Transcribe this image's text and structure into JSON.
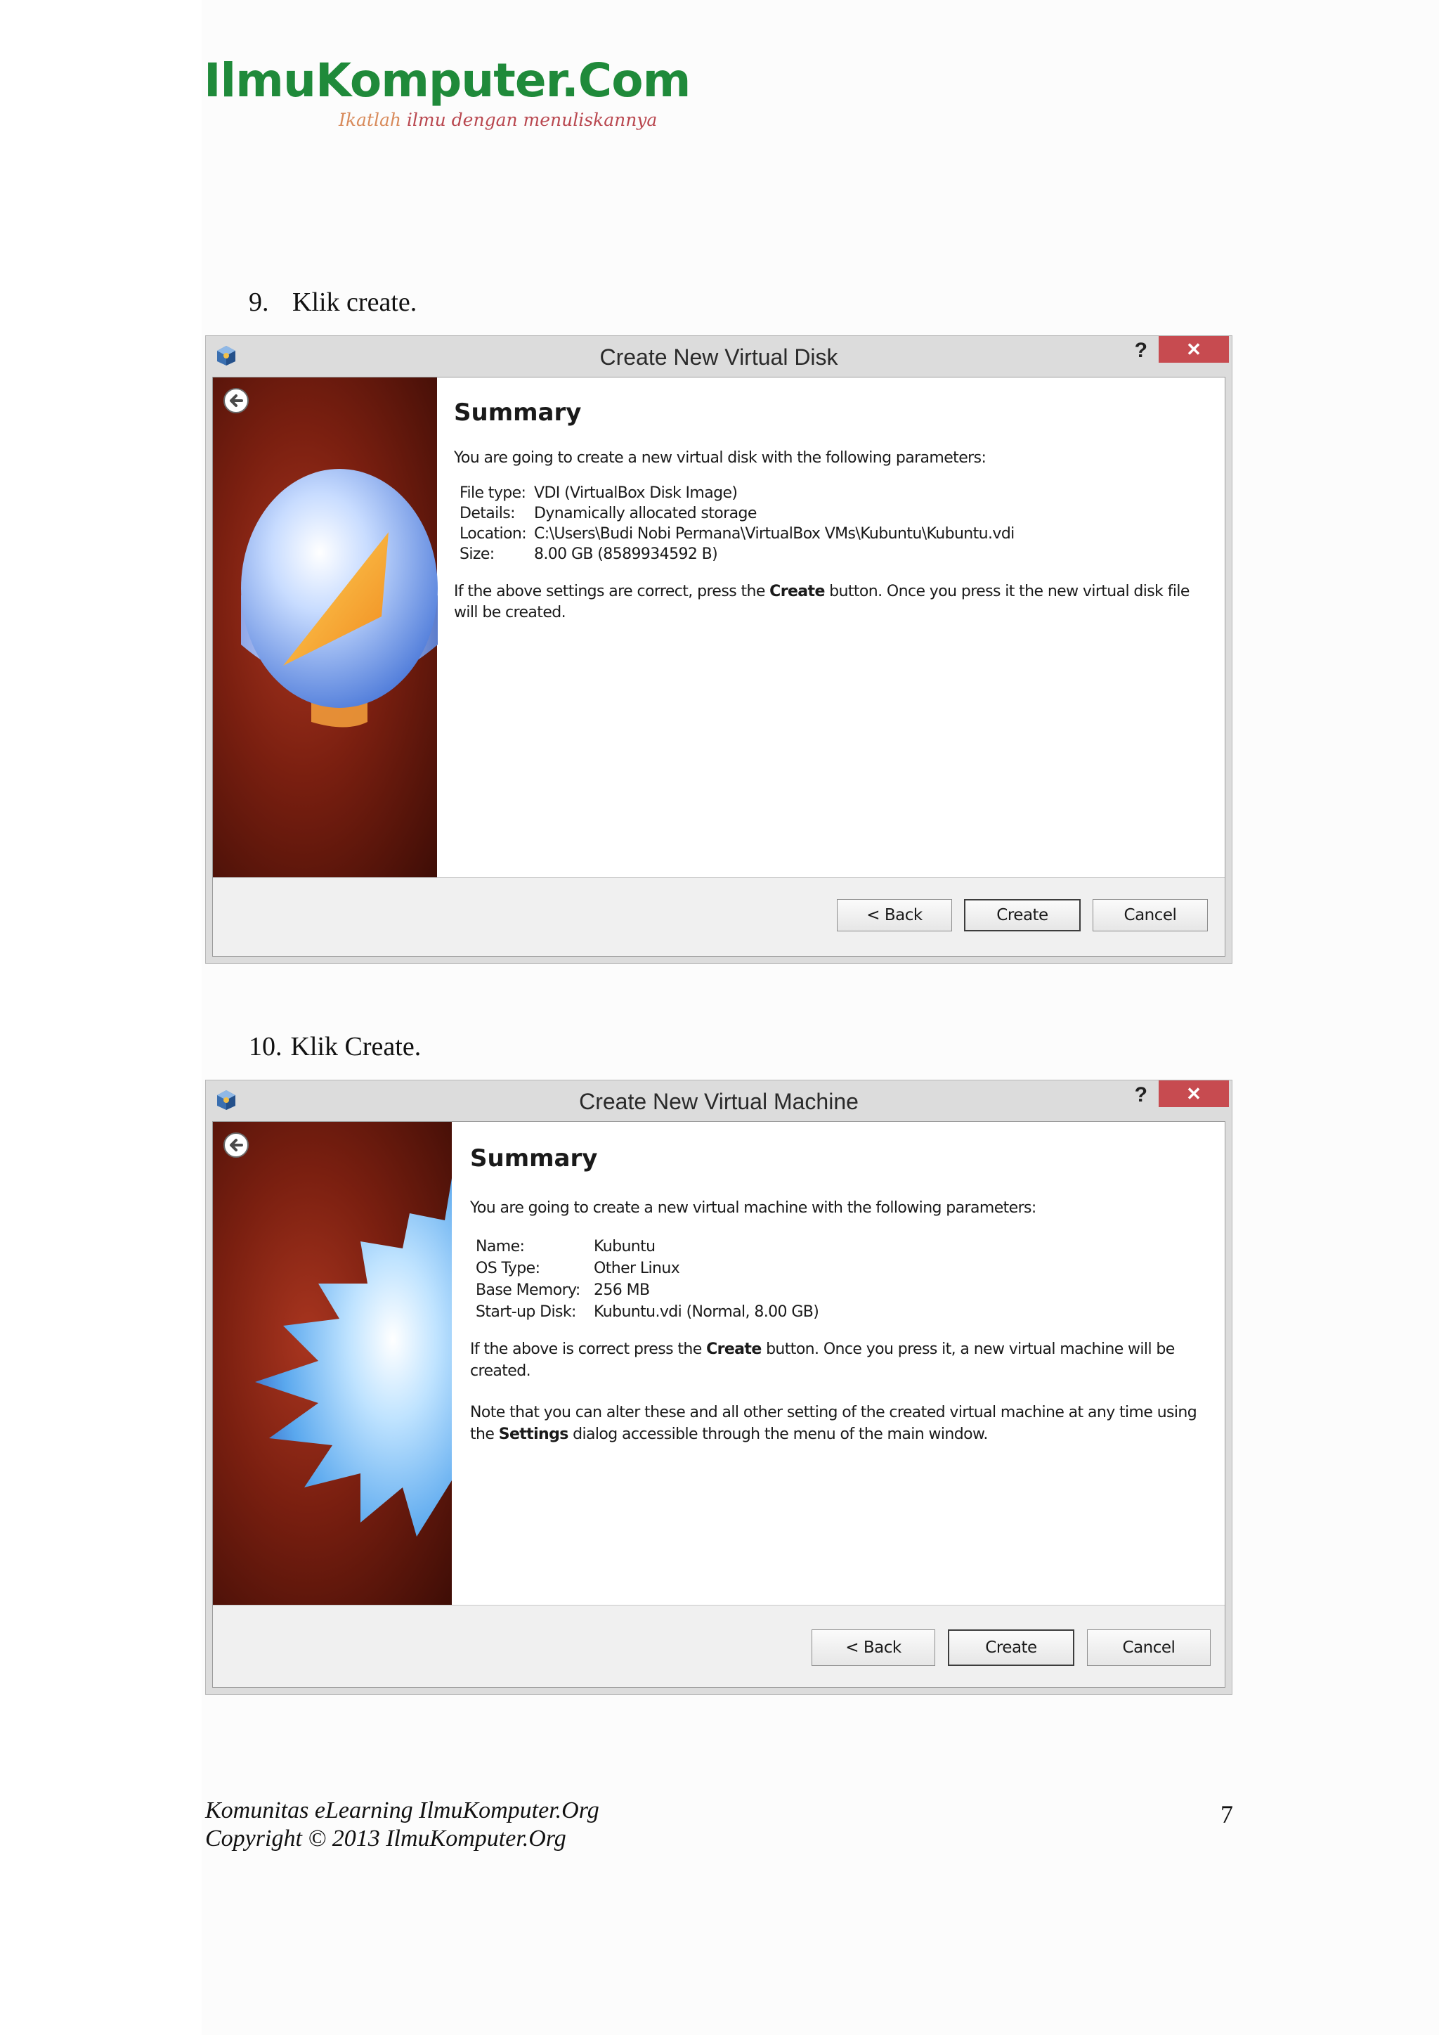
{
  "header": {
    "logo_title": "IlmuKomputer.Com",
    "logo_tagline_lead": "Ikatlah",
    "logo_tagline_rest": " ilmu dengan menuliskannya"
  },
  "step9": {
    "number": "9.",
    "text": "Klik create."
  },
  "step10": {
    "number": "10.",
    "text": "Klik Create."
  },
  "dialog_disk": {
    "title": "Create New Virtual Disk",
    "help": "?",
    "close": "✕",
    "summary_title": "Summary",
    "intro": "You are going to create a new virtual disk with the following parameters:",
    "params": [
      {
        "label": "File type:",
        "value": "VDI (VirtualBox Disk Image)"
      },
      {
        "label": "Details:",
        "value": "Dynamically allocated storage"
      },
      {
        "label": "Location:",
        "value": "C:\\Users\\Budi Nobi Permana\\VirtualBox VMs\\Kubuntu\\Kubuntu.vdi"
      },
      {
        "label": "Size:",
        "value": "8.00 GB (8589934592 B)"
      }
    ],
    "note_pre": "If the above settings are correct, press the ",
    "note_bold": "Create",
    "note_post": " button. Once you press it the new virtual disk file will be created.",
    "buttons": {
      "back": "< Back",
      "create": "Create",
      "cancel": "Cancel"
    }
  },
  "dialog_vm": {
    "title": "Create New Virtual Machine",
    "help": "?",
    "close": "✕",
    "summary_title": "Summary",
    "intro": "You are going to create a new virtual machine with the following parameters:",
    "params": [
      {
        "label": "Name:",
        "value": "Kubuntu"
      },
      {
        "label": "OS Type:",
        "value": "Other Linux"
      },
      {
        "label": "Base Memory:",
        "value": "256 MB"
      },
      {
        "label": "Start-up Disk:",
        "value": "Kubuntu.vdi (Normal, 8.00 GB)"
      }
    ],
    "note1_pre": "If the above is correct press the ",
    "note1_bold": "Create",
    "note1_post": " button. Once you press it, a new virtual machine will be created.",
    "note2_pre": "Note that you can alter these and all other setting of the created virtual machine at any time using the ",
    "note2_bold": "Settings",
    "note2_post": " dialog accessible through the menu of the main window.",
    "buttons": {
      "back": "< Back",
      "create": "Create",
      "cancel": "Cancel"
    }
  },
  "footer": {
    "line1": "Komunitas eLearning IlmuKomputer.Org",
    "line2": "Copyright © 2013 IlmuKomputer.Org",
    "page_number": "7"
  }
}
